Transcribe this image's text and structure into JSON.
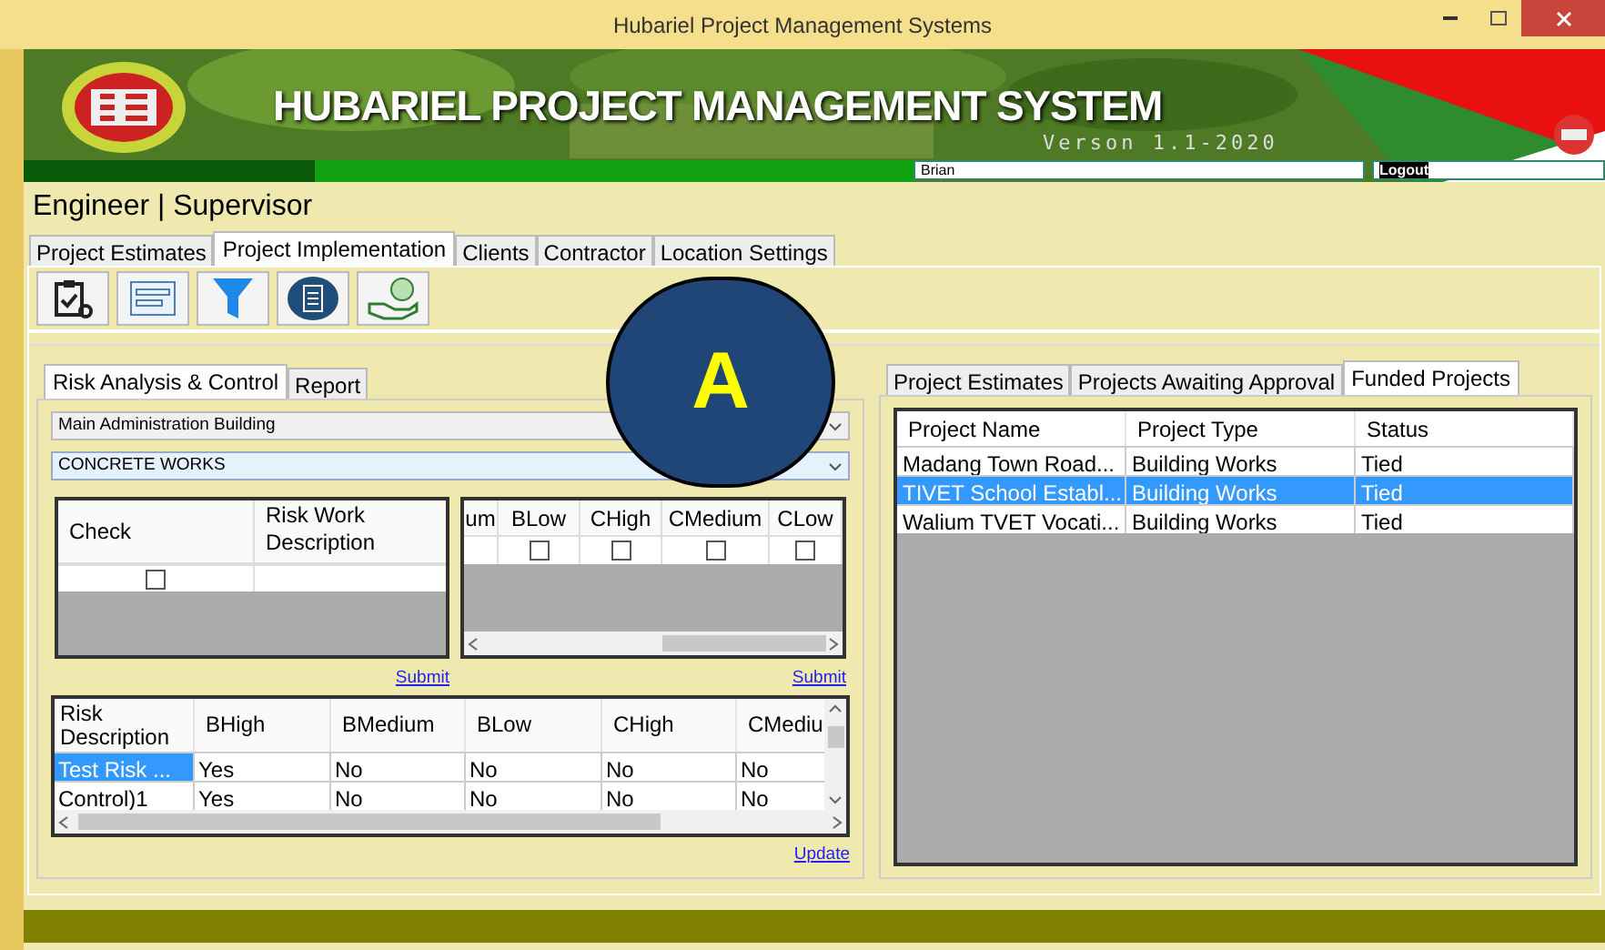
{
  "window": {
    "title": "Hubariel Project Management Systems"
  },
  "banner": {
    "title": "HUBARIEL PROJECT MANAGEMENT SYSTEM",
    "version": "Verson 1.1-2020",
    "user": "Brian",
    "logout": "Logout"
  },
  "role": "Engineer | Supervisor",
  "main_tabs": [
    {
      "label": "Project Estimates",
      "selected": false
    },
    {
      "label": "Project Implementation",
      "selected": true
    },
    {
      "label": "Clients",
      "selected": false
    },
    {
      "label": "Contractor",
      "selected": false
    },
    {
      "label": "Location Settings",
      "selected": false
    }
  ],
  "left_tabs": [
    {
      "label": "Risk Analysis & Control",
      "selected": true
    },
    {
      "label": "Report",
      "selected": false
    }
  ],
  "building_select": "Main Administration Building",
  "works_select": "CONCRETE WORKS",
  "check_grid": {
    "columns": [
      "Check",
      "Risk Work Description"
    ],
    "rows": [
      {
        "checked": false
      }
    ]
  },
  "criteria_grid": {
    "columns": [
      "um",
      "BLow",
      "CHigh",
      "CMedium",
      "CLow"
    ],
    "rows": [
      {
        "checks": [
          false,
          false,
          false,
          false
        ]
      }
    ]
  },
  "submit_links": [
    "Submit",
    "Submit"
  ],
  "risk_table": {
    "columns": [
      "Risk Description",
      "BHigh",
      "BMedium",
      "BLow",
      "CHigh",
      "CMediu"
    ],
    "rows": [
      {
        "cells": [
          "Test Risk ...",
          "Yes",
          "No",
          "No",
          "No",
          "No"
        ],
        "selected": true
      },
      {
        "cells": [
          "Control)1",
          "Yes",
          "No",
          "No",
          "No",
          "No"
        ],
        "selected": false
      }
    ]
  },
  "update_link": "Update",
  "right_tabs": [
    {
      "label": "Project Estimates",
      "selected": false
    },
    {
      "label": "Projects Awaiting Approval",
      "selected": false
    },
    {
      "label": "Funded Projects",
      "selected": true
    }
  ],
  "projects_table": {
    "columns": [
      "Project Name",
      "Project Type",
      "Status"
    ],
    "rows": [
      {
        "cells": [
          "Madang Town Road...",
          "Building Works",
          "Tied"
        ],
        "selected": false
      },
      {
        "cells": [
          "TIVET School Establ...",
          "Building Works",
          "Tied"
        ],
        "selected": true
      },
      {
        "cells": [
          "Walium TVET Vocati...",
          "Building Works",
          "Tied"
        ],
        "selected": false
      }
    ]
  },
  "annotation": "A"
}
